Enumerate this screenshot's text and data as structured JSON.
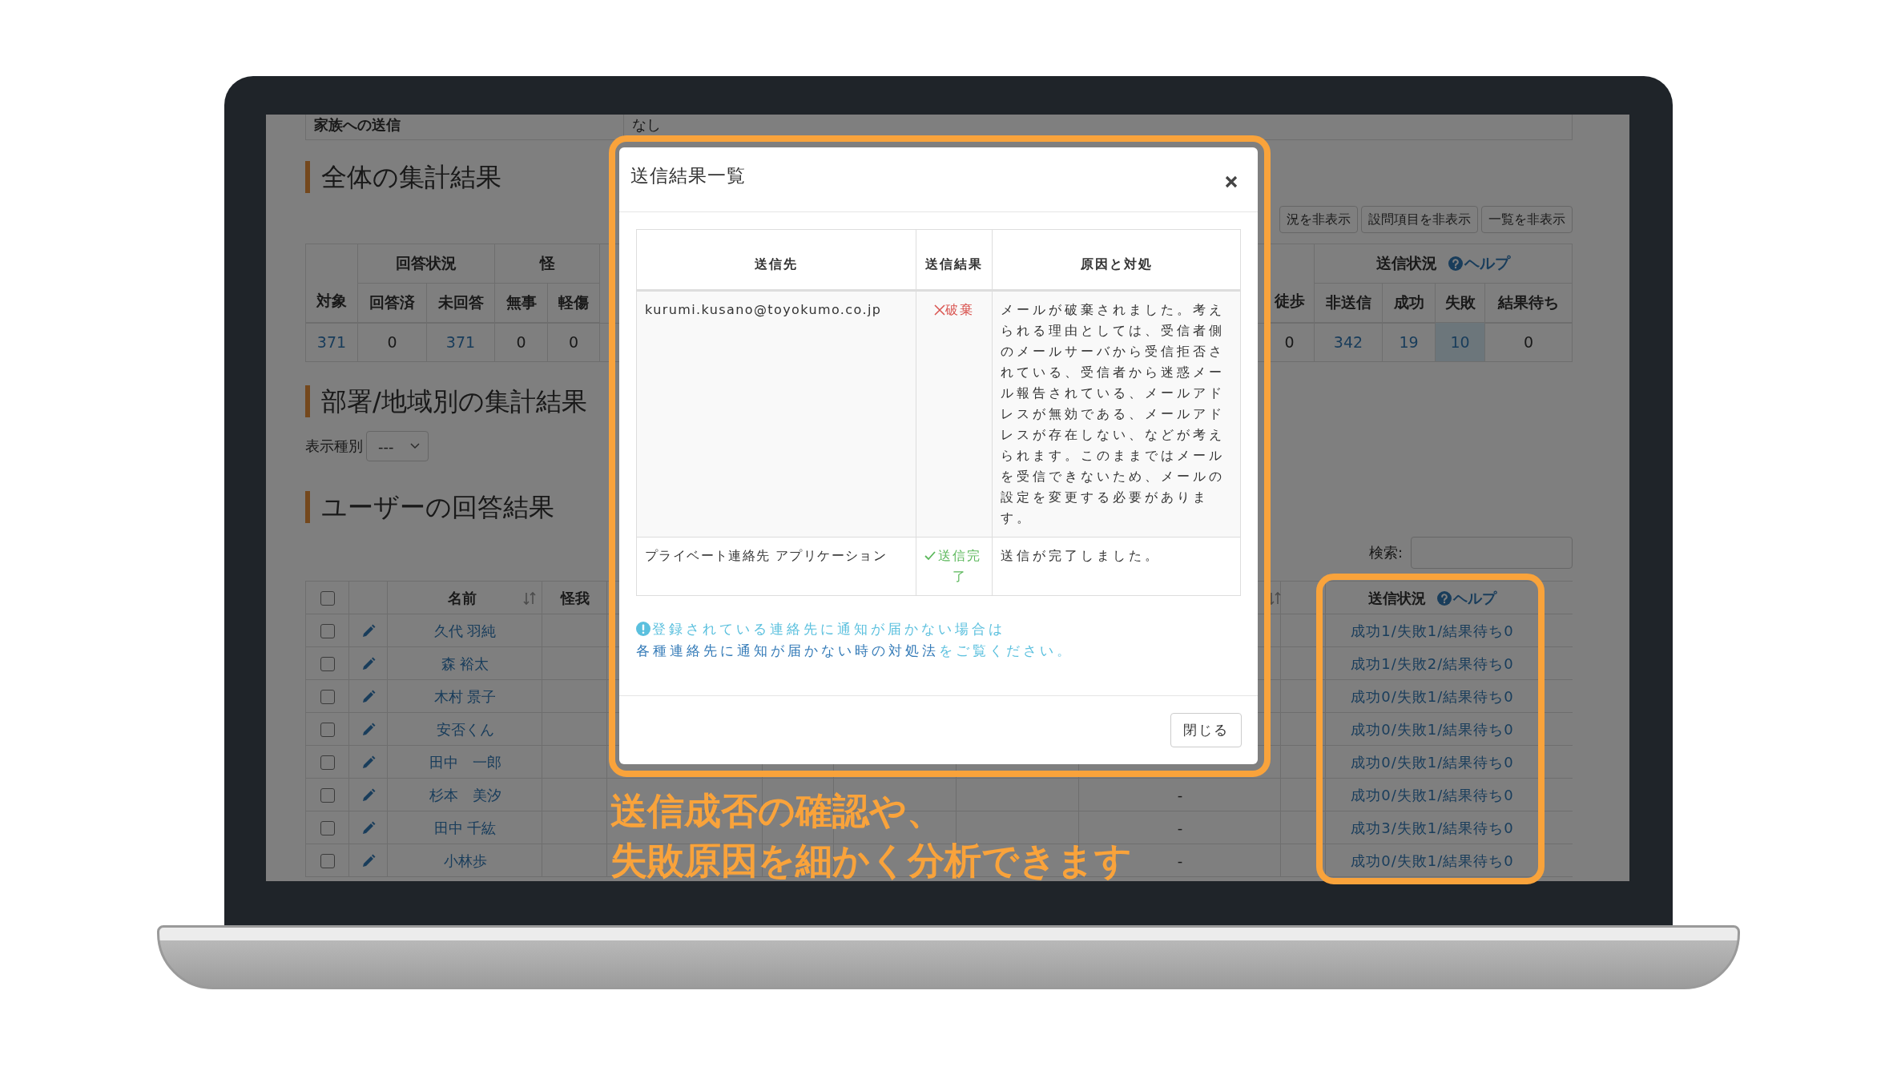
{
  "top_row": {
    "label": "家族への送信",
    "value": "なし"
  },
  "summary_heading": "全体の集計結果",
  "toggle_buttons": [
    "況を非表示",
    "設問項目を非表示",
    "一覧を非表示"
  ],
  "summary_table": {
    "left": [
      {
        "columns": [
          {
            "label": "対象",
            "value": "371",
            "link": true,
            "highlighted": false
          }
        ]
      },
      {
        "label": "回答状況",
        "columns": [
          {
            "label": "回答済",
            "value": "0",
            "link": false,
            "highlighted": false
          },
          {
            "label": "未回答",
            "value": "371",
            "link": true,
            "highlighted": false
          }
        ]
      },
      {
        "label": "怪",
        "columns": [
          {
            "label": "無事",
            "value": "0",
            "link": false,
            "highlighted": false
          },
          {
            "label": "軽傷",
            "value": "0",
            "link": false,
            "highlighted": false
          }
        ]
      }
    ],
    "right": [
      {
        "columns": [
          {
            "label": "徒歩",
            "value": "0",
            "link": false,
            "highlighted": false
          }
        ]
      },
      {
        "label": "送信状況",
        "help": "ヘルプ",
        "columns": [
          {
            "label": "非送信",
            "value": "342",
            "link": true,
            "highlighted": false
          },
          {
            "label": "成功",
            "value": "19",
            "link": true,
            "highlighted": false
          },
          {
            "label": "失敗",
            "value": "10",
            "link": true,
            "highlighted": true
          },
          {
            "label": "結果待ち",
            "value": "0",
            "link": false,
            "highlighted": false
          }
        ]
      }
    ]
  },
  "department_heading": "部署/地域別の集計結果",
  "display_type": {
    "label": "表示種別",
    "value": "---"
  },
  "users_heading": "ユーザーの回答結果",
  "search": {
    "label": "検索:"
  },
  "users_table": {
    "all_checked": false,
    "name_header": "名前",
    "injury_header": "怪我",
    "status_header": "送信状況",
    "status_help": "ヘルプ",
    "rows": [
      {
        "checked": false,
        "name": "久代 羽純",
        "status": "成功1/失敗1/結果待ち0"
      },
      {
        "checked": false,
        "name": "森 裕太",
        "status": "成功1/失敗2/結果待ち0"
      },
      {
        "checked": false,
        "name": "木村 景子",
        "status": "成功0/失敗1/結果待ち0"
      },
      {
        "checked": false,
        "name": "安否くん",
        "status": "成功0/失敗1/結果待ち0"
      },
      {
        "checked": false,
        "name": "田中　一郎",
        "status": "成功0/失敗1/結果待ち0"
      },
      {
        "checked": false,
        "name": "杉本　美汐",
        "column_9": "-",
        "status": "成功0/失敗1/結果待ち0"
      },
      {
        "checked": false,
        "name": "田中 千紘",
        "column_9": "-",
        "status": "成功3/失敗1/結果待ち0"
      },
      {
        "checked": false,
        "name": "小林歩",
        "column_9": "-",
        "status": "成功0/失敗1/結果待ち0"
      }
    ]
  },
  "modal": {
    "title": "送信結果一覧",
    "columns": [
      "送信先",
      "送信結果",
      "原因と対処"
    ],
    "rows": [
      {
        "recipient": "kurumi.kusano@toyokumo.co.jp",
        "kind": "discarded",
        "result": "破棄",
        "detail": "メールが破棄されました。考えられる理由としては、受信者側のメールサーバから受信拒否されている、受信者から迷惑メール報告されている、メールアドレスが無効である、メールアドレスが存在しない、などが考えられます。このままではメールを受信できないため、メールの設定を変更する必要があります。"
      },
      {
        "recipient": "プライベート連絡先 アプリケーション",
        "kind": "delivered",
        "result": "送信完了",
        "detail": "送信が完了しました。"
      }
    ],
    "note": {
      "before": "登録されている連絡先に通知が届かない場合は",
      "link": "各種連絡先に通知が届かない時の対処法",
      "after": "をご覧ください。"
    },
    "close_button": "閉じる"
  },
  "caption": [
    "送信成否の確認や、",
    "失敗原因を細かく分析できます"
  ]
}
